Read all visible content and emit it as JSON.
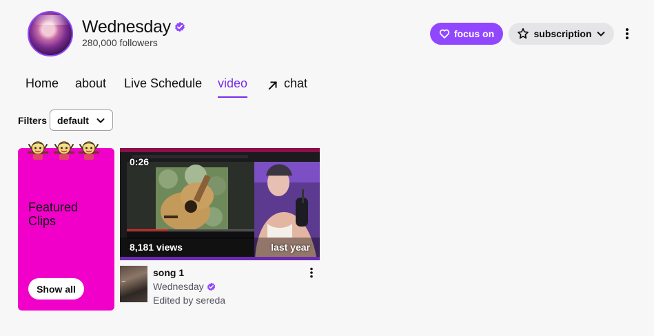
{
  "channel": {
    "name": "Wednesday",
    "followers": "280,000 followers",
    "verified_icon": "verified-badge-icon"
  },
  "actions": {
    "follow_label": "focus on",
    "subscribe_label": "subscription",
    "more_icon": "more-vertical-icon"
  },
  "tabs": [
    {
      "label": "Home"
    },
    {
      "label": "about"
    },
    {
      "label": "Live Schedule"
    },
    {
      "label": "video",
      "active": true
    },
    {
      "label": "chat",
      "icon": "external-arrow-icon"
    }
  ],
  "filters": {
    "label": "Filters",
    "selected": "default"
  },
  "featured": {
    "title": "Featured Clips",
    "button": "Show all"
  },
  "clip": {
    "duration": "0:26",
    "views": "8,181 views",
    "date": "last year",
    "title": "song 1",
    "channel": "Wednesday",
    "editor": "Edited by sereda"
  },
  "colors": {
    "accent": "#9147ff",
    "accent_text": "#772ce8",
    "featured_bg": "#f000c8"
  }
}
